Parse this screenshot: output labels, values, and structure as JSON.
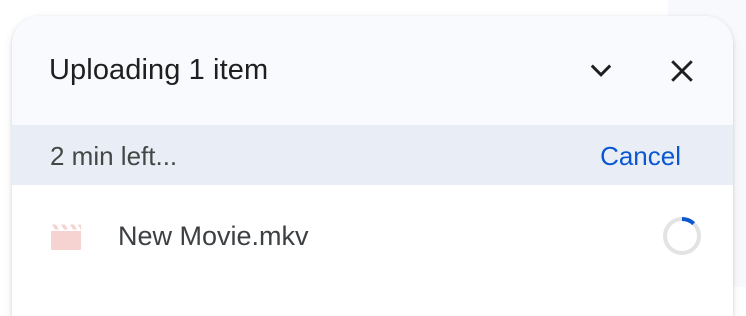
{
  "panel": {
    "title": "Uploading 1 item",
    "collapse_icon": "chevron-down-icon",
    "close_icon": "close-icon"
  },
  "status": {
    "time_left": "2 min left...",
    "cancel_label": "Cancel"
  },
  "uploads": [
    {
      "file_name": "New Movie.mkv",
      "file_type_icon": "video-file-icon",
      "progress_fraction": 0.12
    }
  ],
  "colors": {
    "accent": "#0b57d0",
    "header_bg": "#f8fafd",
    "status_bg": "#e9eef6",
    "video_icon": "#f6d3d1",
    "progress_track": "#e3e3e3"
  }
}
